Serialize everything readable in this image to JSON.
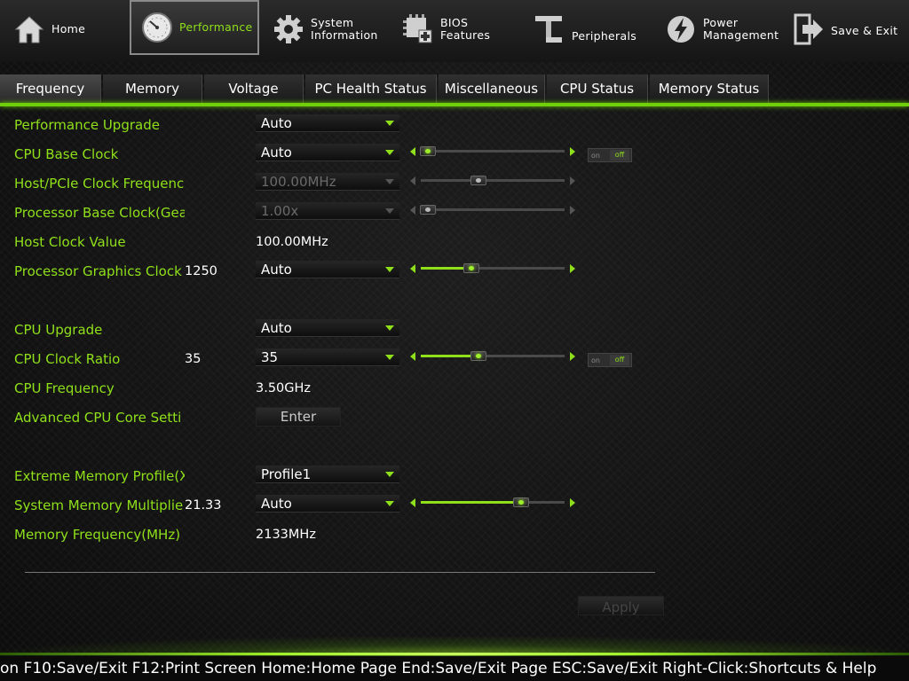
{
  "nav": [
    {
      "label1": "Home",
      "label2": "",
      "icon": "home-icon"
    },
    {
      "label1": "Performance",
      "label2": "",
      "icon": "gauge-icon",
      "active": true
    },
    {
      "label1": "System",
      "label2": "Information",
      "icon": "gear-icon"
    },
    {
      "label1": "BIOS",
      "label2": "Features",
      "icon": "chip-icon"
    },
    {
      "label1": "Peripherals",
      "label2": "",
      "icon": "usb-icon"
    },
    {
      "label1": "Power",
      "label2": "Management",
      "icon": "power-icon"
    },
    {
      "label1": "Save & Exit",
      "label2": "",
      "icon": "exit-icon"
    }
  ],
  "tabs": [
    "Frequency",
    "Memory",
    "Voltage",
    "PC Health Status",
    "Miscellaneous",
    "CPU Status",
    "Memory Status"
  ],
  "rows": {
    "performance_upgrade": {
      "label": "Performance Upgrade",
      "value": "Auto"
    },
    "cpu_base_clock": {
      "label": "CPU Base Clock",
      "value": "Auto",
      "slider": 0.05,
      "toggle_on": "on",
      "toggle_off": "off"
    },
    "host_pcie_clock": {
      "label": "Host/PCIe Clock Frequenc",
      "value": "100.00MHz",
      "slider": 0.4
    },
    "processor_base_clock": {
      "label": "Processor Base Clock(Gea",
      "value": "1.00x",
      "slider": 0.05
    },
    "host_clock_value": {
      "label": "Host Clock Value",
      "value": "100.00MHz"
    },
    "processor_graphics_clock": {
      "label": "Processor Graphics Clock",
      "current": "1250",
      "value": "Auto",
      "slider": 0.35
    },
    "cpu_upgrade": {
      "label": "CPU Upgrade",
      "value": "Auto"
    },
    "cpu_clock_ratio": {
      "label": "CPU Clock Ratio",
      "current": "35",
      "value": "35",
      "slider": 0.4,
      "toggle_on": "on",
      "toggle_off": "off"
    },
    "cpu_frequency": {
      "label": "CPU Frequency",
      "value": "3.50GHz"
    },
    "advanced_cpu_core": {
      "label": "Advanced CPU Core Setti",
      "button": "Enter"
    },
    "xmp": {
      "label": "Extreme Memory Profile(X",
      "value": "Profile1"
    },
    "system_memory_multiplier": {
      "label": "System Memory Multiplie",
      "current": "21.33",
      "value": "Auto",
      "slider": 0.7
    },
    "memory_frequency": {
      "label": "Memory Frequency(MHz)",
      "value": "2133MHz"
    }
  },
  "apply_label": "Apply",
  "footer": "on F10:Save/Exit F12:Print Screen Home:Home Page End:Save/Exit Page ESC:Save/Exit Right-Click:Shortcuts & Help",
  "colors": {
    "accent": "#8fe01a",
    "background": "#121212"
  }
}
